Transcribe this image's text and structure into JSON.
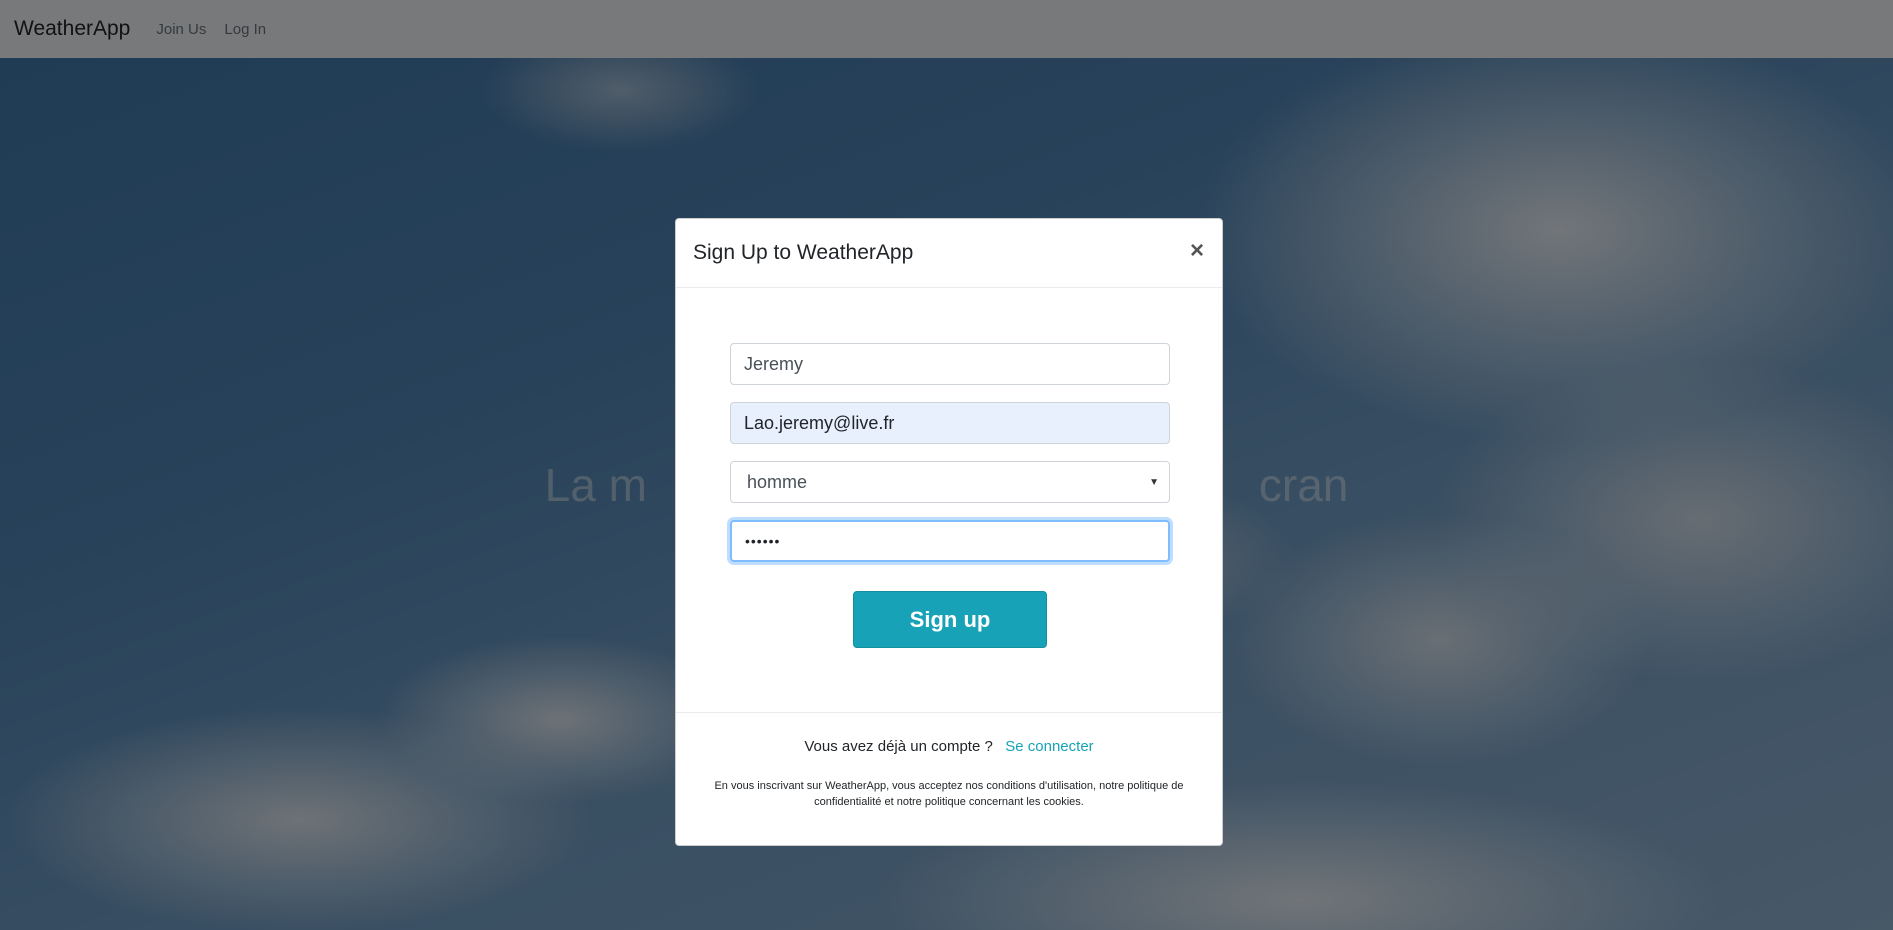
{
  "navbar": {
    "brand": "WeatherApp",
    "links": [
      "Join Us",
      "Log In"
    ]
  },
  "hero": {
    "title": "La m... cran"
  },
  "modal": {
    "title": "Sign Up to WeatherApp",
    "close_symbol": "×",
    "fields": {
      "name_value": "Jeremy",
      "email_value": "Lao.jeremy@live.fr",
      "gender_value": "homme",
      "password_value": "••••••"
    },
    "submit_label": "Sign up",
    "footer": {
      "question": "Vous avez déjà un compte ?",
      "signin_link": "Se connecter",
      "terms": "En vous inscrivant sur WeatherApp, vous acceptez nos conditions d'utilisation, notre politique de confidentialité et notre politique concernant les cookies."
    }
  },
  "colors": {
    "accent": "#17a2b8",
    "focus_border": "#80bdff",
    "autofill_bg": "#e8f0fe"
  },
  "icons": {
    "close": "close-icon",
    "select_arrow": "chevron-down-icon"
  }
}
